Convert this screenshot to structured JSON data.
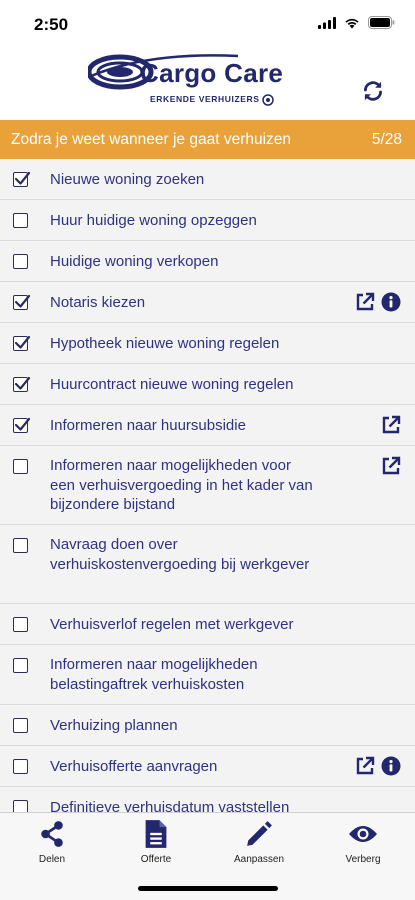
{
  "status_bar": {
    "time": "2:50"
  },
  "header": {
    "logo_title": "Cargo Care",
    "logo_subtitle": "ERKENDE VERHUIZERS"
  },
  "section": {
    "title": "Zodra je weet wanneer je gaat verhuizen",
    "count": "5/28"
  },
  "items": [
    {
      "label": "Nieuwe woning zoeken",
      "checked": true,
      "link": false,
      "info": false
    },
    {
      "label": "Huur huidige woning opzeggen",
      "checked": false,
      "link": false,
      "info": false
    },
    {
      "label": "Huidige woning verkopen",
      "checked": false,
      "link": false,
      "info": false
    },
    {
      "label": "Notaris kiezen",
      "checked": true,
      "link": true,
      "info": true
    },
    {
      "label": "Hypotheek nieuwe woning regelen",
      "checked": true,
      "link": false,
      "info": false
    },
    {
      "label": "Huurcontract nieuwe woning regelen",
      "checked": true,
      "link": false,
      "info": false
    },
    {
      "label": "Informeren naar huursubsidie",
      "checked": true,
      "link": true,
      "info": false
    },
    {
      "label": "Informeren naar mogelijkheden voor een verhuisvergoeding in het kader van bijzondere bijstand",
      "checked": false,
      "link": true,
      "info": false
    },
    {
      "label": "Navraag doen over verhuiskostenvergoeding bij werkgever",
      "checked": false,
      "link": false,
      "info": false
    },
    {
      "label": "Verhuisverlof regelen met werkgever",
      "checked": false,
      "link": false,
      "info": false
    },
    {
      "label": "Informeren naar mogelijkheden belastingaftrek verhuiskosten",
      "checked": false,
      "link": false,
      "info": false
    },
    {
      "label": "Verhuizing plannen",
      "checked": false,
      "link": false,
      "info": false
    },
    {
      "label": "Verhuisofferte aanvragen",
      "checked": false,
      "link": true,
      "info": true
    },
    {
      "label": "Definitieve verhuisdatum vaststellen",
      "checked": false,
      "link": false,
      "info": false
    }
  ],
  "tabs": [
    {
      "label": "Delen",
      "icon": "share-icon"
    },
    {
      "label": "Offerte",
      "icon": "document-icon"
    },
    {
      "label": "Aanpassen",
      "icon": "pencil-icon"
    },
    {
      "label": "Verberg",
      "icon": "eye-icon"
    }
  ],
  "colors": {
    "accent": "#e9a23a",
    "brand": "#23276b",
    "list_bg": "#f3f3f3"
  }
}
